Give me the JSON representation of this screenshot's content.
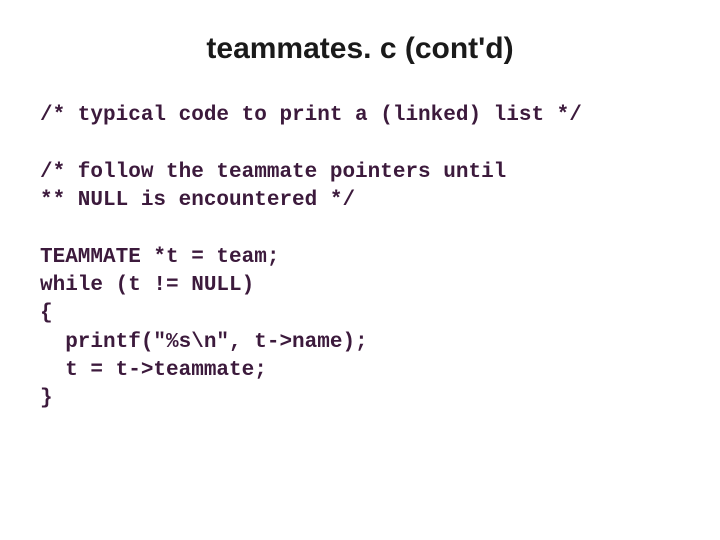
{
  "title": "teammates. c (cont'd)",
  "code": {
    "l1": "/* typical code to print a (linked) list */",
    "l2": "",
    "l3": "/* follow the teammate pointers until",
    "l4": "** NULL is encountered */",
    "l5": "",
    "l6": "TEAMMATE *t = team;",
    "l7": "while (t != NULL)",
    "l8": "{",
    "l9": "  printf(\"%s\\n\", t->name);",
    "l10": "  t = t->teammate;",
    "l11": "}"
  }
}
